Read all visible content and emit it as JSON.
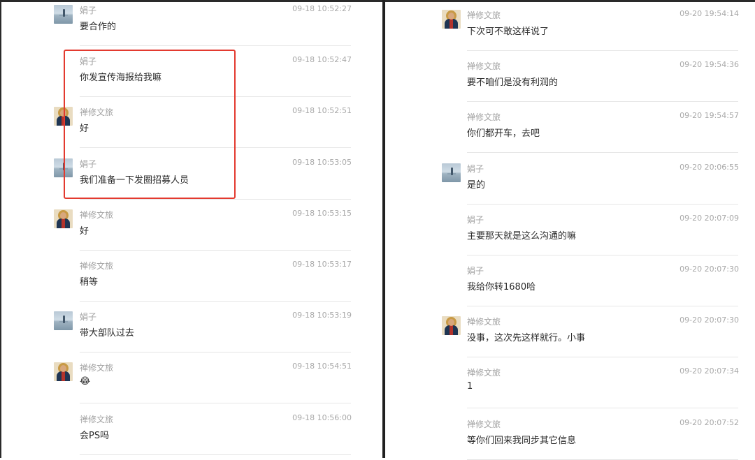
{
  "left_chat": {
    "messages": [
      {
        "sender": "娟子",
        "time": "09-18 10:52:27",
        "text": "要合作的",
        "avatar": "sea"
      },
      {
        "sender": "娟子",
        "time": "09-18 10:52:47",
        "text": "你发宣传海报给我嘛",
        "avatar": "none"
      },
      {
        "sender": "禅修文旅",
        "time": "09-18 10:52:51",
        "text": "好",
        "avatar": "icon"
      },
      {
        "sender": "娟子",
        "time": "09-18 10:53:05",
        "text": "我们准备一下发圈招募人员",
        "avatar": "sea"
      },
      {
        "sender": "禅修文旅",
        "time": "09-18 10:53:15",
        "text": "好",
        "avatar": "icon"
      },
      {
        "sender": "禅修文旅",
        "time": "09-18 10:53:17",
        "text": "稍等",
        "avatar": "none"
      },
      {
        "sender": "娟子",
        "time": "09-18 10:53:19",
        "text": "带大部队过去",
        "avatar": "sea"
      },
      {
        "sender": "禅修文旅",
        "time": "09-18 10:54:51",
        "text": "😂",
        "avatar": "icon"
      },
      {
        "sender": "禅修文旅",
        "time": "09-18 10:56:00",
        "text": "会PS吗",
        "avatar": "none"
      }
    ]
  },
  "right_chat": {
    "messages": [
      {
        "sender": "禅修文旅",
        "time": "09-20 19:54:14",
        "text": "下次可不敢这样说了",
        "avatar": "icon"
      },
      {
        "sender": "禅修文旅",
        "time": "09-20 19:54:36",
        "text": "要不咱们是没有利润的",
        "avatar": "none"
      },
      {
        "sender": "禅修文旅",
        "time": "09-20 19:54:57",
        "text": "你们都开车，去吧",
        "avatar": "none"
      },
      {
        "sender": "娟子",
        "time": "09-20 20:06:55",
        "text": "是的",
        "avatar": "sea"
      },
      {
        "sender": "娟子",
        "time": "09-20 20:07:09",
        "text": "主要那天就是这么沟通的嘛",
        "avatar": "none"
      },
      {
        "sender": "娟子",
        "time": "09-20 20:07:30",
        "text": "我给你转1680哈",
        "avatar": "none"
      },
      {
        "sender": "禅修文旅",
        "time": "09-20 20:07:30",
        "text": "没事，这次先这样就行。小事",
        "avatar": "icon"
      },
      {
        "sender": "禅修文旅",
        "time": "09-20 20:07:34",
        "text": "1",
        "avatar": "none"
      },
      {
        "sender": "禅修文旅",
        "time": "09-20 20:07:52",
        "text": "等你们回来我同步其它信息",
        "avatar": "none"
      }
    ]
  },
  "colors": {
    "highlight": "#e33a2f",
    "frame": "#1f1f1f",
    "name_text": "#a2a2a2",
    "body_text": "#2b2b2b"
  }
}
